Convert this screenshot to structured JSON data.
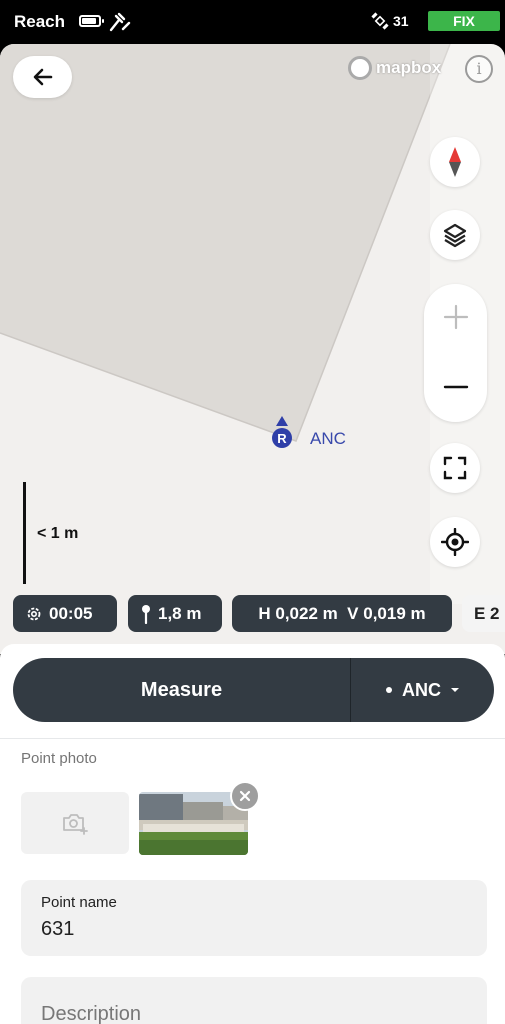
{
  "status_bar": {
    "app_name": "Reach",
    "satellite_count": "31",
    "fix_label": "FIX",
    "fix_color": "#3cb54a",
    "icons": [
      "battery-icon",
      "survey-tool-icon",
      "satellite-icon"
    ]
  },
  "map": {
    "attribution": "mapbox",
    "marker": {
      "badge": "R",
      "label": "ANC",
      "color": "#2f3fa8"
    },
    "scale_label": "< 1 m",
    "buttons": [
      "back-arrow-icon",
      "compass-icon",
      "layers-icon",
      "zoom-in-icon",
      "zoom-out-icon",
      "fit-screen-icon",
      "locate-icon"
    ]
  },
  "chips": {
    "time": "00:05",
    "antenna_height": "1,8 m",
    "precision": "H 0,022 m  V 0,019 m",
    "partial": "E 2"
  },
  "sheet": {
    "measure_label": "Measure",
    "base_label": "ANC",
    "photo_section_title": "Point photo",
    "point_name_label": "Point name",
    "point_name_value": "631",
    "description_placeholder": "Description"
  }
}
